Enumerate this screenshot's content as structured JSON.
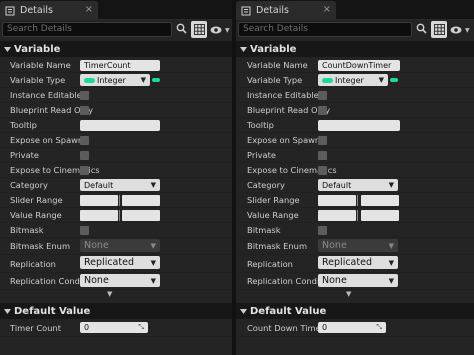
{
  "left": {
    "tab_title": "Details",
    "search_placeholder": "Search Details",
    "section_variable": "Variable",
    "props": {
      "variable_name_label": "Variable Name",
      "variable_name_value": "TimerCount",
      "variable_type_label": "Variable Type",
      "variable_type_value": "Integer",
      "instance_editable_label": "Instance Editable",
      "blueprint_read_only_label": "Blueprint Read Only",
      "tooltip_label": "Tooltip",
      "expose_on_spawn_label": "Expose on Spawn",
      "private_label": "Private",
      "expose_to_cinematics_label": "Expose to Cinematics",
      "category_label": "Category",
      "category_value": "Default",
      "slider_range_label": "Slider Range",
      "value_range_label": "Value Range",
      "bitmask_label": "Bitmask",
      "bitmask_enum_label": "Bitmask Enum",
      "bitmask_enum_value": "None",
      "replication_label": "Replication",
      "replication_value": "Replicated",
      "replication_condition_label": "Replication Condition",
      "replication_condition_value": "None"
    },
    "section_default": "Default Value",
    "default_prop_label": "Timer Count",
    "default_prop_value": "0"
  },
  "right": {
    "tab_title": "Details",
    "search_placeholder": "Search Details",
    "section_variable": "Variable",
    "props": {
      "variable_name_label": "Variable Name",
      "variable_name_value": "CountDownTimer",
      "variable_type_label": "Variable Type",
      "variable_type_value": "Integer",
      "instance_editable_label": "Instance Editable",
      "blueprint_read_only_label": "Blueprint Read Only",
      "tooltip_label": "Tooltip",
      "expose_on_spawn_label": "Expose on Spawn",
      "private_label": "Private",
      "expose_to_cinematics_label": "Expose to Cinematics",
      "category_label": "Category",
      "category_value": "Default",
      "slider_range_label": "Slider Range",
      "value_range_label": "Value Range",
      "bitmask_label": "Bitmask",
      "bitmask_enum_label": "Bitmask Enum",
      "bitmask_enum_value": "None",
      "replication_label": "Replication",
      "replication_value": "Replicated",
      "replication_condition_label": "Replication Condition",
      "replication_condition_value": "None"
    },
    "section_default": "Default Value",
    "default_prop_label": "Count Down Timer",
    "default_prop_value": "0"
  },
  "colors": {
    "integer_pin": "#1fd69c",
    "panel_bg": "#242424",
    "header_bg": "#171717"
  },
  "icons": [
    "details-tab-icon",
    "close-icon",
    "search-icon",
    "grid-view-icon",
    "eye-icon",
    "collapse-arrow-icon",
    "expand-advanced-icon",
    "drag-grip-icon",
    "chevron-down-icon"
  ]
}
